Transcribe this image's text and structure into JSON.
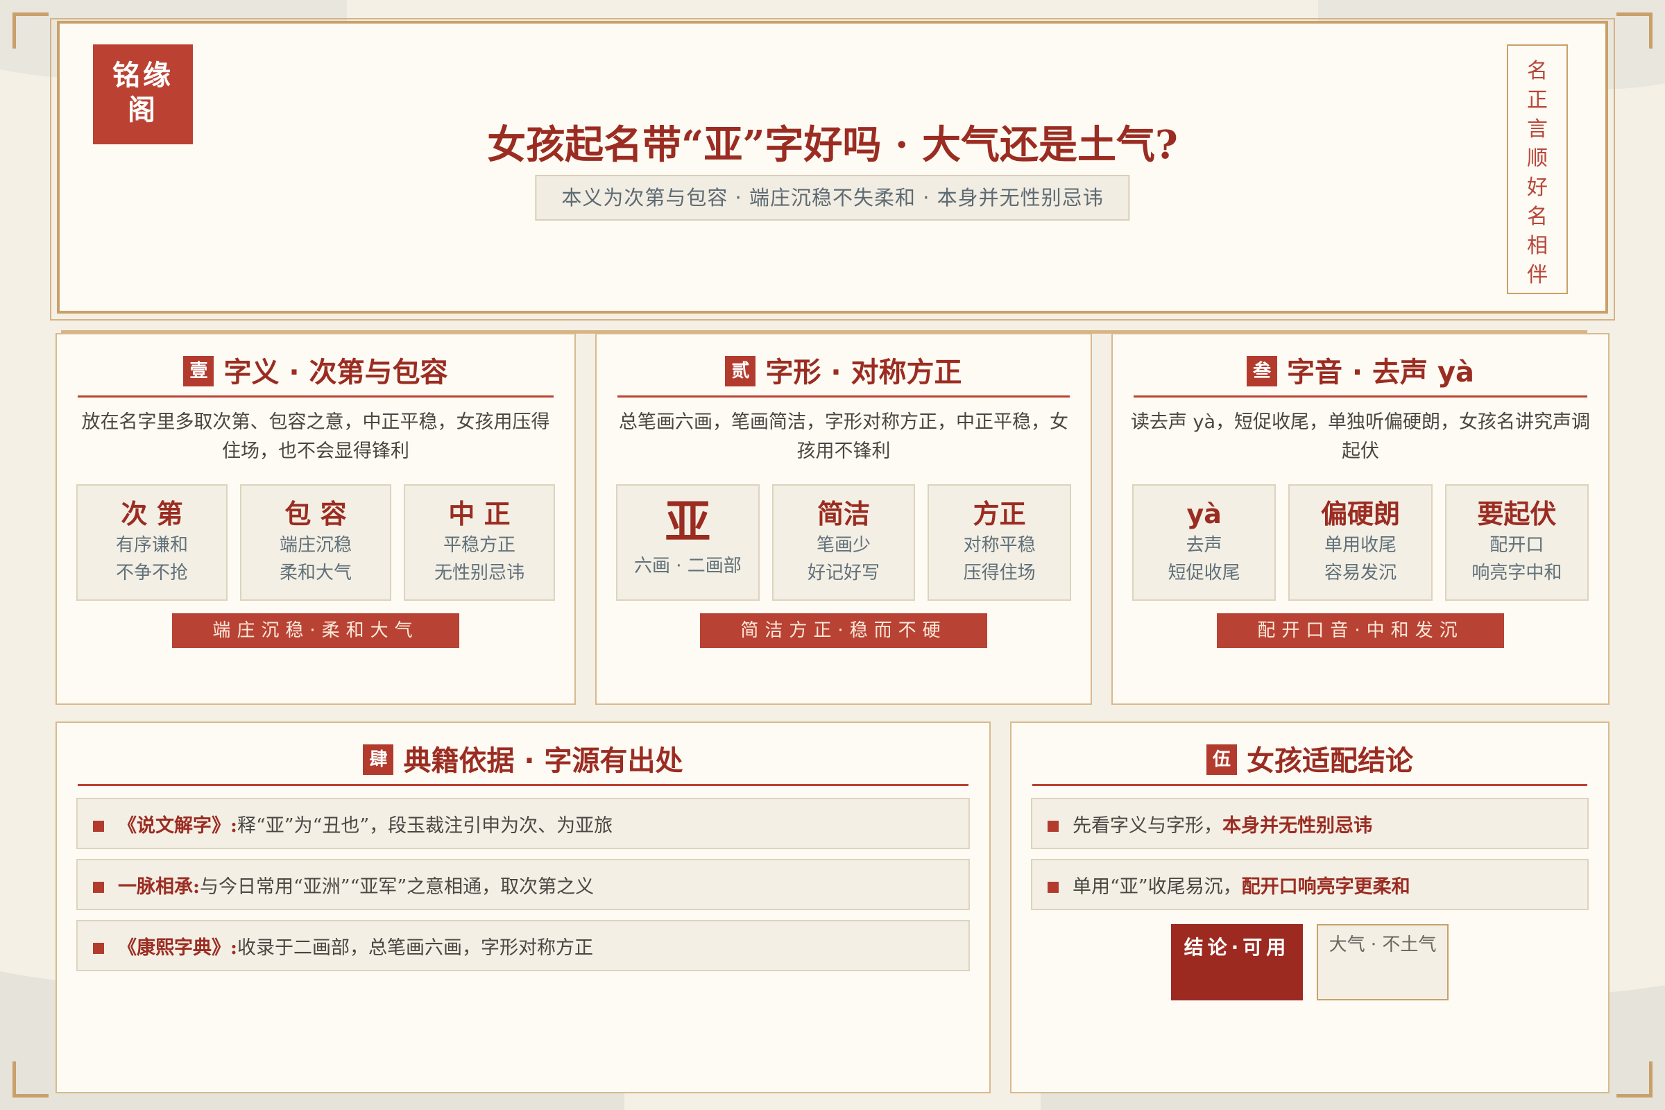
{
  "brand": {
    "logo_line1": "铭缘",
    "logo_line2": "阁"
  },
  "header": {
    "title": "女孩起名带“亚”字好吗 · 大气还是土气?",
    "subtitle": "本义为次第与包容 · 端庄沉稳不失柔和 · 本身并无性别忌讳",
    "seal": [
      "名",
      "正",
      "言",
      "顺",
      "好",
      "名",
      "相",
      "伴"
    ]
  },
  "cards": {
    "meaning": {
      "num": "壹",
      "title": "字义 · 次第与包容",
      "desc": "放在名字里多取次第、包容之意，中正平稳，女孩用压得住场，也不会显得锋利",
      "boxes": [
        {
          "head": "次 第",
          "line1": "有序谦和",
          "line2": "不争不抢"
        },
        {
          "head": "包 容",
          "line1": "端庄沉稳",
          "line2": "柔和大气"
        },
        {
          "head": "中 正",
          "line1": "平稳方正",
          "line2": "无性别忌讳"
        }
      ],
      "ribbon": "端庄沉稳·柔和大气"
    },
    "shape": {
      "num": "贰",
      "title": "字形 · 对称方正",
      "desc": "总笔画六画，笔画简洁，字形对称方正，中正平稳，女孩用不锋利",
      "boxes": [
        {
          "head": "亚",
          "line1": "六画 · 二画部",
          "line2": ""
        },
        {
          "head": "简洁",
          "line1": "笔画少",
          "line2": "好记好写"
        },
        {
          "head": "方正",
          "line1": "对称平稳",
          "line2": "压得住场"
        }
      ],
      "ribbon": "简洁方正·稳而不硬"
    },
    "sound": {
      "num": "叁",
      "title": "字音 · 去声 yà",
      "desc": "读去声 yà，短促收尾，单独听偏硬朗，女孩名讲究声调起伏",
      "boxes": [
        {
          "head": "yà",
          "line1": "去声",
          "line2": "短促收尾"
        },
        {
          "head": "偏硬朗",
          "line1": "单用收尾",
          "line2": "容易发沉"
        },
        {
          "head": "要起伏",
          "line1": "配开口",
          "line2": "响亮字中和"
        }
      ],
      "ribbon": "配开口音·中和发沉"
    },
    "sources": {
      "num": "肆",
      "title": "典籍依据 · 字源有出处",
      "items": [
        {
          "label": "《说文解字》:",
          "text": "释“亚”为“丑也”，段玉裁注引申为次、为亚旅"
        },
        {
          "label": "一脉相承:",
          "text": "与今日常用“亚洲”“亚军”之意相通，取次第之义"
        },
        {
          "label": "《康熙字典》:",
          "text": "收录于二画部，总笔画六画，字形对称方正"
        }
      ]
    },
    "conclusion": {
      "num": "伍",
      "title": "女孩适配结论",
      "items": [
        {
          "text": "先看字义与字形，",
          "label": "本身并无性别忌讳"
        },
        {
          "text": "单用“亚”收尾易沉，",
          "label": "配开口响亮字更柔和"
        }
      ],
      "verdict": "结论·可用",
      "verdict_note": "大气 · 不土气"
    }
  },
  "colors": {
    "accent": "#9b2c22",
    "ribbon": "#b84234",
    "gold": "#c9a06a",
    "paper": "#fdfbf3"
  }
}
